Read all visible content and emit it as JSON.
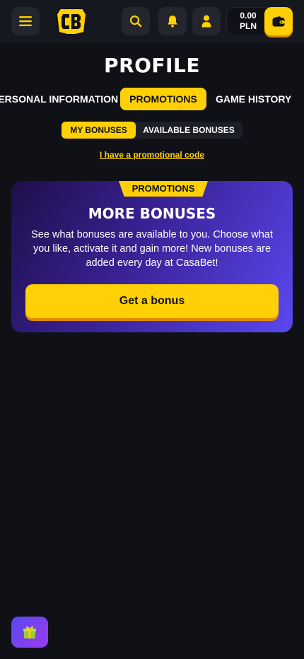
{
  "header": {
    "balance_amount": "0.00",
    "balance_currency": "PLN",
    "icons": [
      "menu-icon",
      "logo",
      "search-icon",
      "bell-icon",
      "user-icon",
      "wallet-icon"
    ],
    "accent_color": "#ffd006"
  },
  "page": {
    "title": "PROFILE"
  },
  "tabs": [
    {
      "label": "PERSONAL INFORMATION",
      "active": false
    },
    {
      "label": "PROMOTIONS",
      "active": true
    },
    {
      "label": "GAME HISTORY",
      "active": false
    }
  ],
  "subtabs": [
    {
      "label": "MY BONUSES",
      "active": true
    },
    {
      "label": "AVAILABLE BONUSES",
      "active": false
    }
  ],
  "promo_code_link": "I have a promotional code",
  "promo_card": {
    "tag": "PROMOTIONS",
    "title": "MORE BONUSES",
    "text": "See what bonuses are available to you. Choose what you like, activate it and gain more! New bonuses are added every day at CasaBet!",
    "button_label": "Get a bonus"
  },
  "floating": {
    "icon": "gift-icon"
  }
}
